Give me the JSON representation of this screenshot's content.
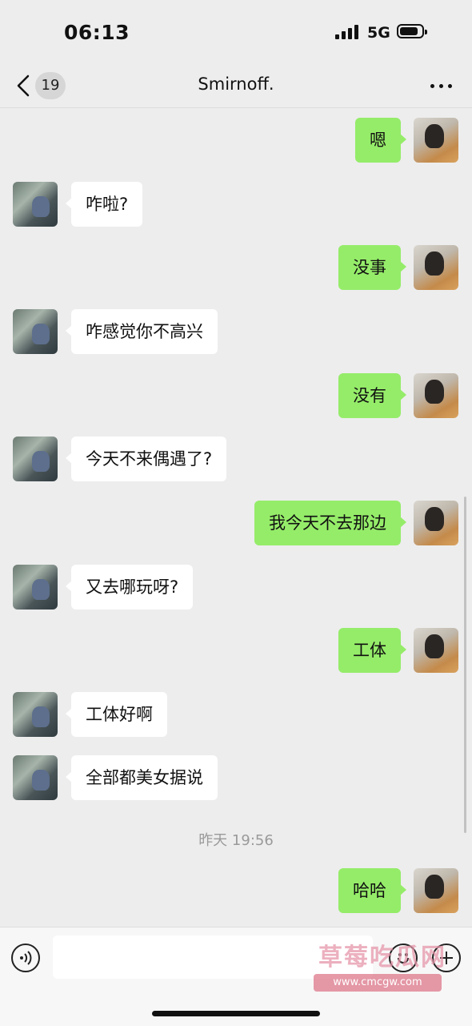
{
  "status_bar": {
    "time": "06:13",
    "network": "5G",
    "battery_level": 0.85
  },
  "nav": {
    "back_badge": "19",
    "title": "Smirnoff.",
    "more_icon": "ellipsis-icon"
  },
  "messages": [
    {
      "from": "self",
      "text": "嗯"
    },
    {
      "from": "friend",
      "text": "咋啦?"
    },
    {
      "from": "self",
      "text": "没事"
    },
    {
      "from": "friend",
      "text": "咋感觉你不高兴"
    },
    {
      "from": "self",
      "text": "没有"
    },
    {
      "from": "friend",
      "text": "今天不来偶遇了?"
    },
    {
      "from": "self",
      "text": "我今天不去那边"
    },
    {
      "from": "friend",
      "text": "又去哪玩呀?"
    },
    {
      "from": "self",
      "text": "工体"
    },
    {
      "from": "friend",
      "text": "工体好啊"
    },
    {
      "from": "friend",
      "text": "全部都美女据说"
    },
    {
      "from": "self",
      "text": "哈哈"
    }
  ],
  "timestamp": "昨天 19:56",
  "input_bar": {
    "value": "",
    "voice_icon": "voice-icon",
    "emoji_icon": "emoji-icon",
    "plus_icon": "plus-icon"
  },
  "watermark": {
    "title": "草莓吃瓜网",
    "url": "www.cmcgw.com"
  },
  "colors": {
    "background": "#ededed",
    "outgoing_bubble": "#95ec69",
    "incoming_bubble": "#ffffff",
    "timestamp": "#9a9a9a"
  }
}
